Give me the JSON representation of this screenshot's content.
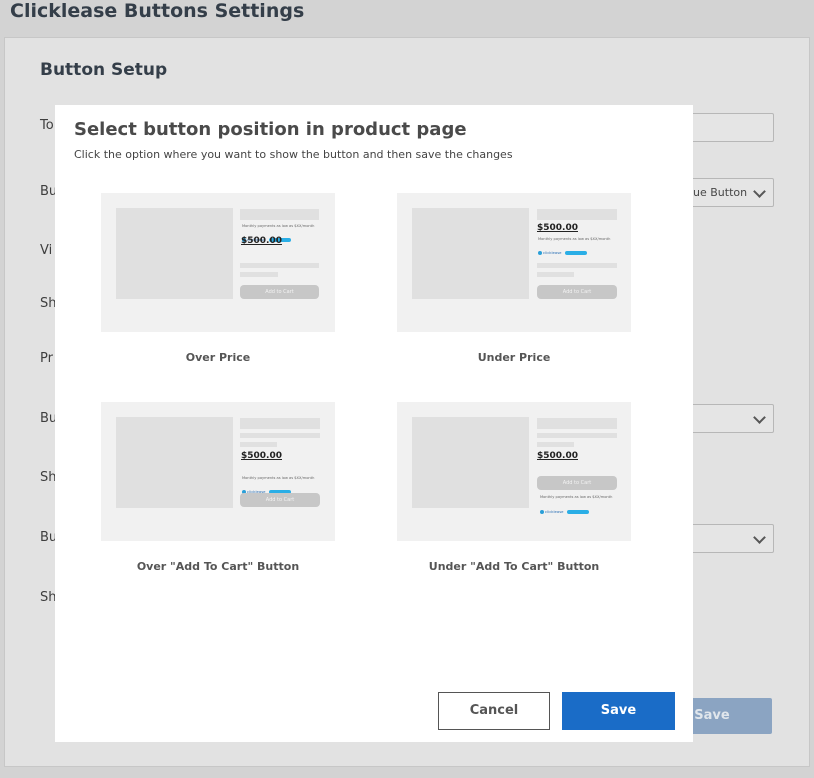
{
  "page": {
    "title": "Clicklease Buttons Settings",
    "section_title": "Button Setup",
    "labels": [
      "To",
      "Bu",
      "Vi",
      "Sh",
      "Pr",
      "Bu",
      "Sh",
      "Bu",
      "Sh"
    ],
    "button_style_value": "ue Button",
    "save_label": "Save"
  },
  "modal": {
    "title": "Select button position in product page",
    "subtitle": "Click the option where you want to show the button and then save the changes",
    "options": [
      {
        "label": "Over Price"
      },
      {
        "label": "Under Price"
      },
      {
        "label": "Over \"Add To Cart\" Button"
      },
      {
        "label": "Under \"Add To Cart\" Button"
      }
    ],
    "preview": {
      "price": "$500.00",
      "add_to_cart": "Add to Cart",
      "financing_text": "Monthly payments as low as $XX/month",
      "logo_text": "clicklease"
    },
    "cancel_label": "Cancel",
    "save_label": "Save"
  },
  "colors": {
    "primary": "#1a6cc7",
    "clicklease_blue": "#2aaee6"
  }
}
